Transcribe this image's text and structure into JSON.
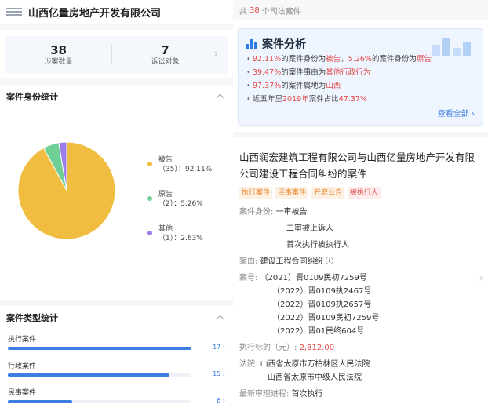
{
  "company": {
    "name": "山西亿量房地产开发有限公司"
  },
  "summary": {
    "cases_count": "38",
    "cases_label": "涉案数量",
    "targets_count": "7",
    "targets_label": "诉讼对象"
  },
  "identity_stats": {
    "title": "案件身份统计",
    "legend": [
      {
        "name": "被告",
        "value": "（35）：92.11%",
        "color": "#f0bd40"
      },
      {
        "name": "原告",
        "value": "（2）：5.26%",
        "color": "#6fcf97"
      },
      {
        "name": "其他",
        "value": "（1）：2.63%",
        "color": "#9b7ee8"
      }
    ]
  },
  "chart_data": {
    "type": "pie",
    "categories": [
      "被告",
      "原告",
      "其他"
    ],
    "values": [
      35,
      2,
      1
    ],
    "percents": [
      92.11,
      5.26,
      2.63
    ],
    "colors": [
      "#f0bd40",
      "#6fcf97",
      "#9b7ee8"
    ],
    "legend_position": "right"
  },
  "type_stats": {
    "title": "案件类型统计",
    "items": [
      {
        "label": "执行案件",
        "count": "17",
        "arrow": "›",
        "fraction": 1.0
      },
      {
        "label": "行政案件",
        "count": "15",
        "arrow": "›",
        "fraction": 0.88
      },
      {
        "label": "民事案件",
        "count": "6",
        "arrow": "›",
        "fraction": 0.35
      }
    ]
  },
  "right_header": {
    "prefix": "共",
    "count": "38",
    "suffix": "个司法案件"
  },
  "analysis": {
    "title": "案件分析",
    "lines": [
      [
        "92.11%",
        "的案件身份为",
        "被告",
        "，",
        "5.26%",
        "的案件身份为",
        "原告"
      ],
      [
        "39.47%",
        "的案件事由为",
        "其他行政行为"
      ],
      [
        "97.37%",
        "的案件属地为",
        "山西"
      ],
      [
        "近五年里",
        "2019年",
        "案件占比",
        "47.37%"
      ]
    ],
    "more": "查看全部"
  },
  "case": {
    "title": "山西润宏建筑工程有限公司与山西亿量房地产开发有限公司建设工程合同纠纷的案件",
    "tags": [
      "执行案件",
      "民事案件",
      "开庭公告",
      "被执行人"
    ],
    "identity_label": "案件身份:",
    "identities": [
      "一审被告",
      "二审被上诉人",
      "首次执行被执行人"
    ],
    "cause_label": "案由:",
    "cause": "建设工程合同纠纷 ⓘ",
    "number_label": "案号:",
    "numbers": [
      "（2021）晋0109民初7259号",
      "（2022）晋0109执2467号",
      "（2022）晋0109执2657号",
      "（2022）晋0109民初7259号",
      "（2022）晋01民终604号"
    ],
    "amount_label": "执行标的（元）:",
    "amount": "2,812.00",
    "court_label": "法院:",
    "courts": [
      "山西省太原市万柏林区人民法院",
      "山西省太原市中级人民法院"
    ],
    "progress_label": "最新审理进程:",
    "progress": "首次执行"
  }
}
